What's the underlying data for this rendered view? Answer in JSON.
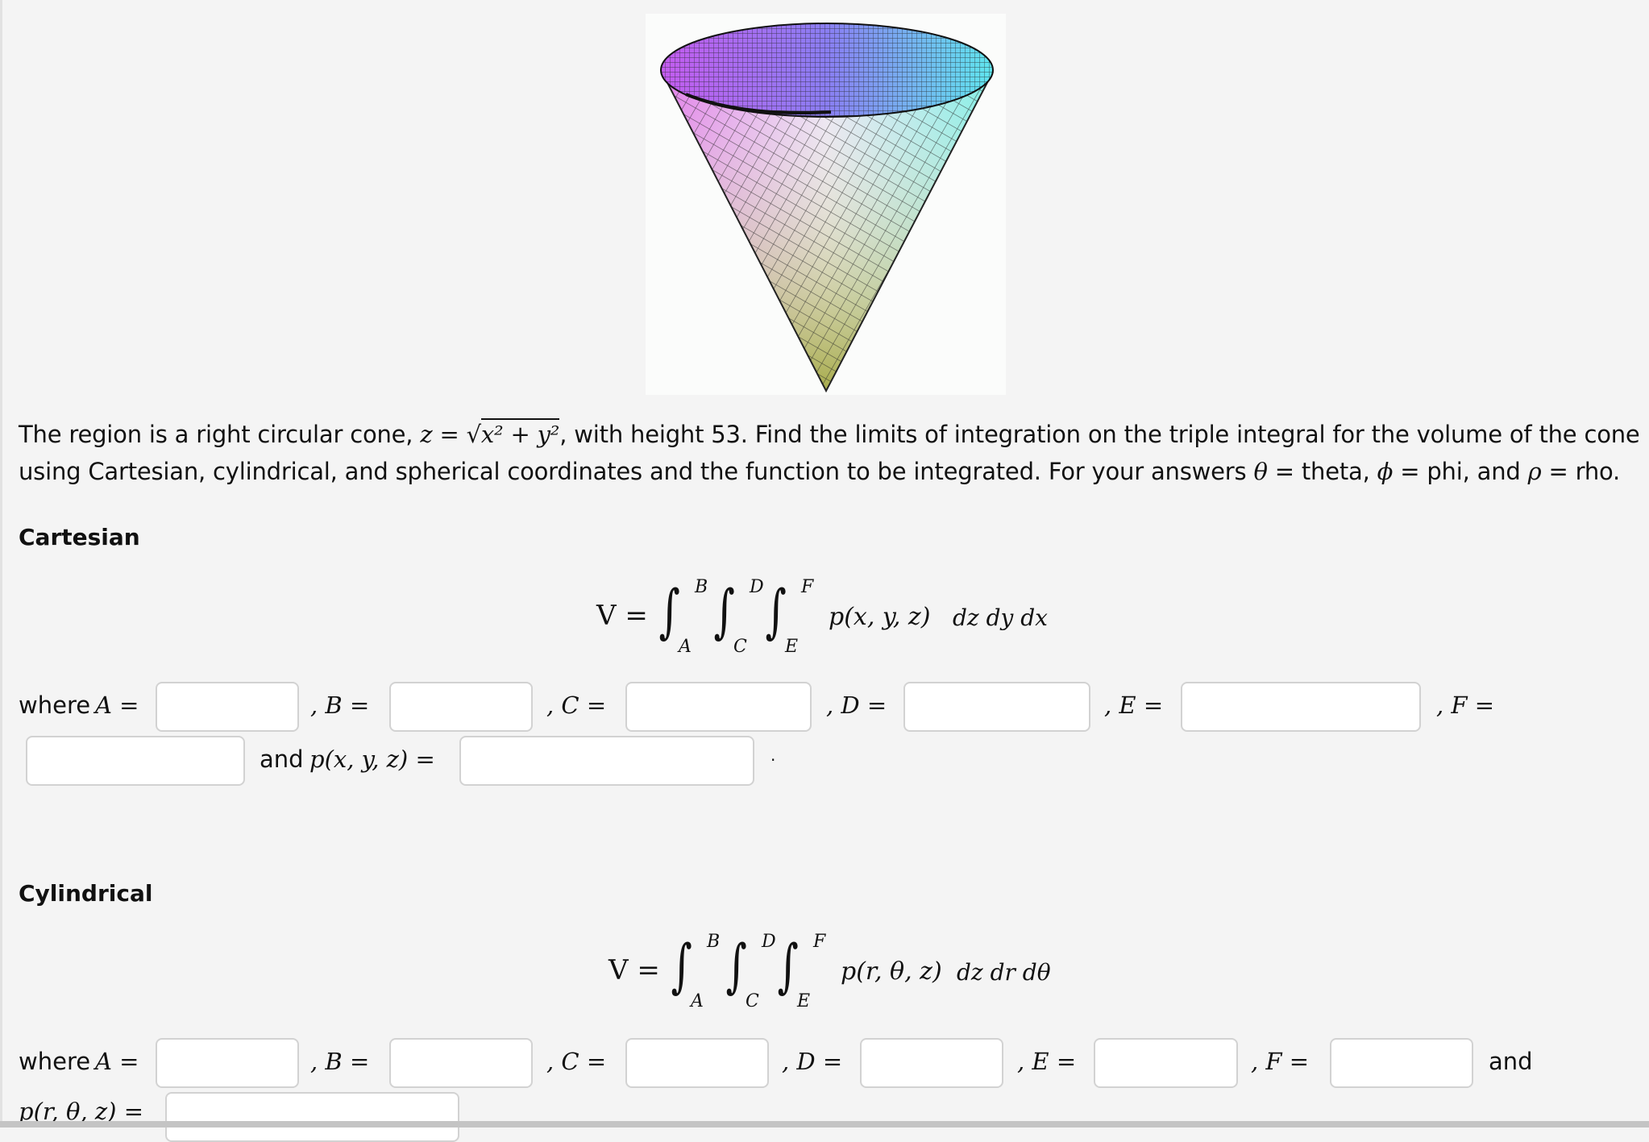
{
  "figure": {
    "alt": "Right circular cone mesh plot",
    "colors": {
      "top_left": "#c45cf0",
      "top_right": "#5fe6ee",
      "bottom_tip": "#a8ac4c",
      "center": "#ece6f4"
    }
  },
  "problem": {
    "intro_line1_a": "The region is a right circular cone, ",
    "cone_eq_lhs": "z",
    "cone_eq_eq": "=",
    "cone_eq_rhs": "x² + y²",
    "intro_line1_b": ", with height 53. Find the limits of integration on the triple integral for the volume of the cone",
    "intro_line2_a": "using Cartesian, cylindrical, and spherical coordinates and the function to be integrated. For your answers ",
    "theta_sym": "θ",
    "theta_eq": " = theta, ",
    "phi_sym": "ϕ",
    "phi_eq": " = phi, and ",
    "rho_sym": "ρ",
    "rho_eq": " = rho.",
    "height": 53
  },
  "cartesian": {
    "heading": "Cartesian",
    "formula": {
      "lhs": "V =",
      "upper": [
        "B",
        "D",
        "F"
      ],
      "lower": [
        "A",
        "C",
        "E"
      ],
      "integrand": "p(x, y, z)",
      "differentials": "dz dy dx"
    },
    "where": "where",
    "labels": {
      "A": "A =",
      "B": ", B =",
      "C": ", C =",
      "D": ", D =",
      "E": ", E =",
      "F": ", F ="
    },
    "and_label": "and",
    "p_label": "p(x, y, z) =",
    "period": ".",
    "values": {
      "A": "",
      "B": "",
      "C": "",
      "D": "",
      "E": "",
      "F": "",
      "p": ""
    }
  },
  "cylindrical": {
    "heading": "Cylindrical",
    "formula": {
      "lhs": "V =",
      "upper": [
        "B",
        "D",
        "F"
      ],
      "lower": [
        "A",
        "C",
        "E"
      ],
      "integrand": "p(r, θ, z)",
      "differentials": "dz dr dθ"
    },
    "where": "where",
    "labels": {
      "A": "A =",
      "B": ", B =",
      "C": ", C =",
      "D": ", D =",
      "E": ", E =",
      "F": ", F ="
    },
    "and_label": "and",
    "p_label": "p(r, θ, z) =",
    "values": {
      "A": "",
      "B": "",
      "C": "",
      "D": "",
      "E": "",
      "F": "",
      "p": ""
    }
  }
}
